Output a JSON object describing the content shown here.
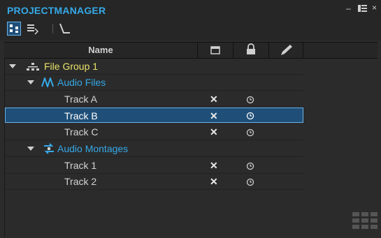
{
  "window": {
    "title": "PROJECTMANAGER",
    "min_label": "–",
    "close_label": "×"
  },
  "toolbar": {
    "icons": [
      "tree-view-icon",
      "list-view-icon",
      "path-icon"
    ]
  },
  "columns": {
    "name": "Name",
    "icons": [
      "window-icon",
      "lock-icon",
      "pencil-icon"
    ]
  },
  "tree": {
    "group": {
      "label": "File Group 1",
      "color": "#e8e26a"
    },
    "folders": [
      {
        "label": "Audio Files",
        "color": "#35a9e8",
        "items": [
          {
            "label": "Track A",
            "selected": false
          },
          {
            "label": "Track B",
            "selected": true
          },
          {
            "label": "Track C",
            "selected": false
          }
        ]
      },
      {
        "label": "Audio Montages",
        "color": "#35a9e8",
        "items": [
          {
            "label": "Track 1",
            "selected": false
          },
          {
            "label": "Track 2",
            "selected": false
          }
        ]
      }
    ],
    "x_glyph": "✕"
  },
  "colors": {
    "accent": "#35a9e8",
    "selection": "#1f4f78"
  }
}
